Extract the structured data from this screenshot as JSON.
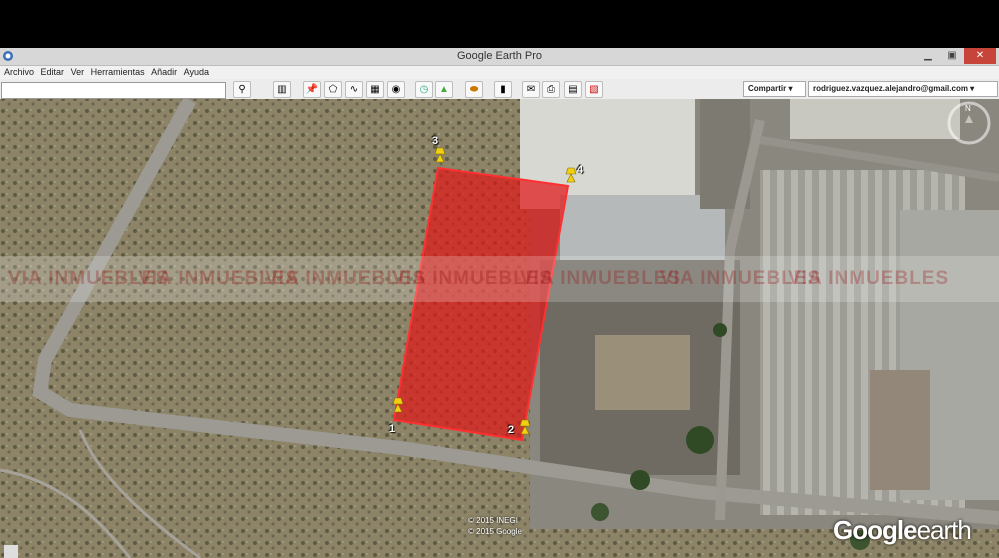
{
  "window": {
    "title": "Google Earth Pro"
  },
  "menu": [
    "Archivo",
    "Editar",
    "Ver",
    "Herramientas",
    "Añadir",
    "Ayuda"
  ],
  "toolbar": {
    "search_placeholder": "",
    "share_label": "Compartir",
    "account_label": "rodriguez.vazquez.alejandro@gmail.com"
  },
  "map": {
    "pins": [
      "1",
      "2",
      "3",
      "4"
    ],
    "watermark": "INMUEBLES",
    "watermark_prefix": "VIA",
    "copyright_1": "© 2015 INEGI",
    "copyright_2": "© 2015 Google",
    "brand_google": "Google",
    "brand_earth": "earth",
    "compass_label": "N",
    "polygon_color": "#e01818"
  }
}
